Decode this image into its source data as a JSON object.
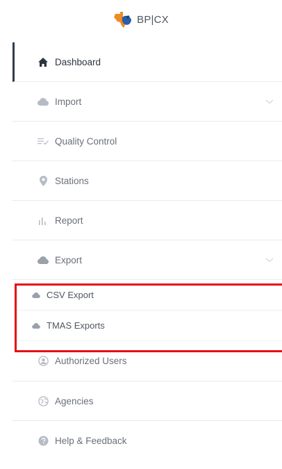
{
  "brand": {
    "logo_icon": "texas-state-logo-icon",
    "text": "BP|CX"
  },
  "nav": {
    "items": [
      {
        "label": "Dashboard",
        "icon": "home-icon",
        "active": true
      },
      {
        "label": "Import",
        "icon": "cloud-icon",
        "expandable": true
      },
      {
        "label": "Quality Control",
        "icon": "list-check-icon"
      },
      {
        "label": "Stations",
        "icon": "map-pin-icon"
      },
      {
        "label": "Report",
        "icon": "bar-chart-icon"
      },
      {
        "label": "Export",
        "icon": "cloud-icon",
        "expandable": true,
        "expanded": true
      },
      {
        "label": "Authorized Users",
        "icon": "user-circle-icon"
      },
      {
        "label": "Agencies",
        "icon": "globe-icon"
      },
      {
        "label": "Help & Feedback",
        "icon": "help-icon"
      }
    ],
    "export_sub_items": [
      {
        "label": "CSV Export",
        "icon": "cloud-icon"
      },
      {
        "label": "TMAS Exports",
        "icon": "cloud-icon"
      }
    ]
  },
  "colors": {
    "active_text": "#2b3440",
    "active_bar": "#2f3b4c",
    "icon_gray": "#b6bcc4",
    "highlight_border": "#e50914"
  }
}
